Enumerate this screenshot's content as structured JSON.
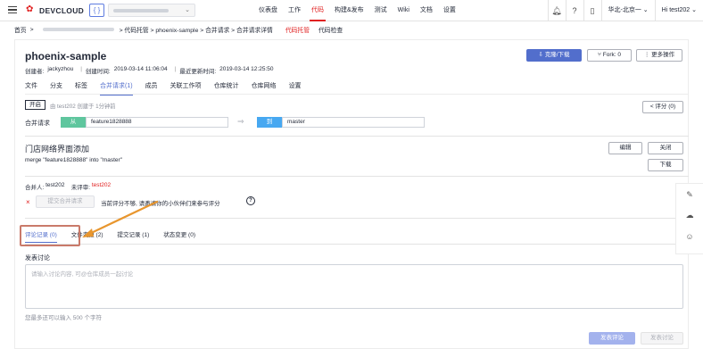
{
  "topbar": {
    "logo_text": "DEVCLOUD",
    "project_icon": "{ }",
    "nav": [
      "仪表盘",
      "工作",
      "代码",
      "构建&发布",
      "测试",
      "Wiki",
      "文档",
      "设置"
    ],
    "active_nav": "代码",
    "region": "华北-北京一",
    "user": "Hi test202"
  },
  "breadcrumb": {
    "home": "首页",
    "path": "> 代码托管 > phoenix-sample > 合并请求 > 合并请求详情",
    "link_active": "代码托管",
    "link_other": "代码检查"
  },
  "repo": {
    "title": "phoenix-sample",
    "creator_label": "创建者:",
    "creator": "jackyzhou",
    "created_label": "创建时间:",
    "created": "2019-03-14 11:06:04",
    "updated_label": "最近更新时间:",
    "updated": "2019-03-14 12:25:50",
    "clone_label": "克隆/下载",
    "fork_label": "Fork: 0",
    "more_label": "更多操作",
    "tabs": [
      "文件",
      "分支",
      "标签",
      "合并请求(1)",
      "成员",
      "关联工作项",
      "仓库统计",
      "仓库网络",
      "设置"
    ],
    "active_tab": "合并请求(1)"
  },
  "merge_request": {
    "status": "开启",
    "status_text": "由 test202 创建于 1分钟前",
    "rating_label": "< 评分 (0)",
    "merge_label": "合并请求",
    "from_tag": "从",
    "from_branch": "feature1828888",
    "to_tag": "到",
    "to_branch": "master",
    "title": "门店网络界面添加",
    "description": "merge \"feature1828888\" into \"master\"",
    "edit_label": "编辑",
    "close_label": "关闭",
    "download_label": "下载",
    "merger_label": "合并人:",
    "merger": "test202",
    "reviewer_label": "未评审:",
    "reviewer": "test202",
    "submit_merge_label": "提交合并请求",
    "warning": "当前评分不够, 请邀请你的小伙伴们来参与评分"
  },
  "sub_tabs": [
    {
      "label": "评论记录 (0)",
      "active": true
    },
    {
      "label": "文件变更 (2)",
      "active": false
    },
    {
      "label": "提交记录 (1)",
      "active": false
    },
    {
      "label": "状态变更 (0)",
      "active": false
    }
  ],
  "comment": {
    "heading": "发表讨论",
    "placeholder": "请输入讨论内容, 可@仓库成员一起讨论",
    "char_limit": "您最多还可以输入 500 个字符",
    "post_label": "发表评论",
    "post_disabled_label": "发表讨论"
  },
  "colors": {
    "brand_red": "#e02020",
    "primary_blue": "#526ecc",
    "from_green": "#5fc69e",
    "to_blue": "#47a8f1",
    "annotation_orange": "#e8962e"
  }
}
